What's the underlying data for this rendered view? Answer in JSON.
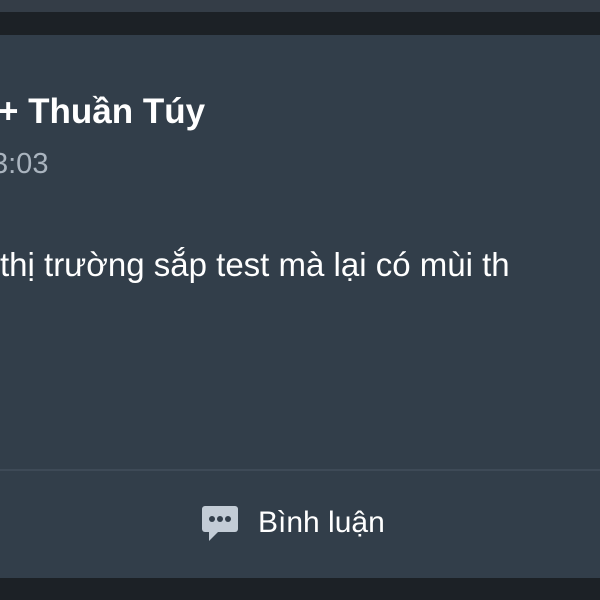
{
  "post": {
    "author": "+ Thuần Túy",
    "time": "3:03",
    "text": "thị trường sắp test mà lại có mùi th"
  },
  "actions": {
    "comment_label": "Bình luận",
    "comment_icon": "speech-bubble-icon"
  },
  "colors": {
    "card_bg": "#323e4a",
    "page_bg": "#1c2126",
    "time_text": "#aab4bf",
    "icon": "#c3ccd6"
  }
}
